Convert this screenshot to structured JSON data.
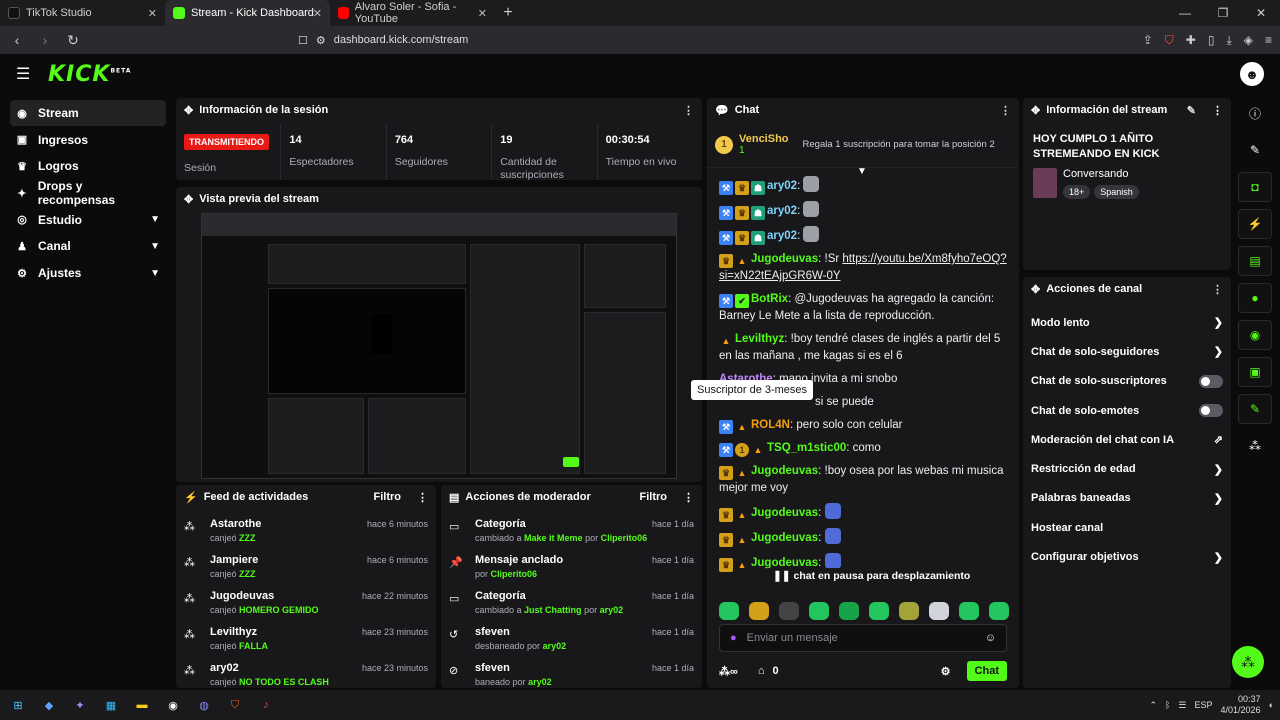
{
  "browser": {
    "tabs": [
      {
        "label": "TikTok Studio",
        "color": "#111111"
      },
      {
        "label": "Stream - Kick Dashboard",
        "color": "#53fc18"
      },
      {
        "label": "Alvaro Soler - Sofia - YouTube",
        "color": "#ff0000"
      }
    ],
    "url": "dashboard.kick.com/stream"
  },
  "header": {
    "logo": "KICK",
    "logo_sup": "BETA"
  },
  "sidebar": {
    "items": [
      {
        "label": "Stream",
        "icon": "broadcast-icon"
      },
      {
        "label": "Ingresos",
        "icon": "revenue-icon"
      },
      {
        "label": "Logros",
        "icon": "trophy-icon"
      },
      {
        "label": "Drops y recompensas",
        "icon": "gift-icon"
      },
      {
        "label": "Estudio",
        "icon": "studio-icon"
      },
      {
        "label": "Canal",
        "icon": "person-icon"
      },
      {
        "label": "Ajustes",
        "icon": "gear-icon"
      }
    ]
  },
  "session": {
    "title": "Información de la sesión",
    "status": "TRANSMITIENDO",
    "stats": [
      {
        "value": "",
        "label": "Sesión"
      },
      {
        "value": "14",
        "label": "Espectadores"
      },
      {
        "value": "764",
        "label": "Seguidores"
      },
      {
        "value": "19",
        "label": "Cantidad de suscripciones"
      },
      {
        "value": "00:30:54",
        "label": "Tiempo en vivo"
      }
    ]
  },
  "preview": {
    "title": "Vista previa del stream"
  },
  "feed": {
    "title": "Feed de actividades",
    "filter": "Filtro",
    "items": [
      {
        "name": "Astarothe",
        "action": "canjeó",
        "reward": "ZZZ",
        "time": "hace 6 minutos"
      },
      {
        "name": "Jampiere",
        "action": "canjeó",
        "reward": "ZZZ",
        "time": "hace 6 minutos"
      },
      {
        "name": "Jugodeuvas",
        "action": "canjeó",
        "reward": "HOMERO GEMIDO",
        "time": "hace 22 minutos"
      },
      {
        "name": "Levilthyz",
        "action": "canjeó",
        "reward": "FALLA",
        "time": "hace 23 minutos"
      },
      {
        "name": "ary02",
        "action": "canjeó",
        "reward": "NO TODO ES CLASH",
        "time": "hace 23 minutos"
      }
    ]
  },
  "mod": {
    "title": "Acciones de moderador",
    "filter": "Filtro",
    "items": [
      {
        "name": "Categoría",
        "pre": "cambiado a",
        "hl": "Make it Meme",
        "mid": "por",
        "by": "Cliperito06",
        "time": "hace 1 día"
      },
      {
        "name": "Mensaje anclado",
        "pre": "por",
        "hl": "Cliperito06",
        "mid": "",
        "by": "",
        "time": "hace 1 día"
      },
      {
        "name": "Categoría",
        "pre": "cambiado a",
        "hl": "Just Chatting",
        "mid": "por",
        "by": "ary02",
        "time": "hace 1 día"
      },
      {
        "name": "sfeven",
        "pre": "desbaneado por",
        "hl": "ary02",
        "mid": "",
        "by": "",
        "time": "hace 1 día"
      },
      {
        "name": "sfeven",
        "pre": "baneado por",
        "hl": "ary02",
        "mid": "",
        "by": "",
        "time": "hace 1 día"
      }
    ]
  },
  "chat": {
    "title": "Chat",
    "pinned_user": "VenciSho",
    "pinned_count": "1",
    "pinned_text": "Regala 1 suscripción para tomar la posición 2",
    "messages": [
      {
        "user": "ary02",
        "color": "#7dd3fc",
        "text": ""
      },
      {
        "user": "ary02",
        "color": "#7dd3fc",
        "text": ""
      },
      {
        "user": "ary02",
        "color": "#7dd3fc",
        "text": ""
      },
      {
        "user": "Jugodeuvas",
        "color": "#53fc18",
        "text": "!Sr",
        "link": "https://youtu.be/Xm8fyho7eOQ?si=xN22tEAjpGR6W-0Y"
      },
      {
        "user": "BotRix",
        "color": "#53fc18",
        "text": "@Jugodeuvas ha agregado la canción: Barney Le Mete a la lista de reproducción."
      },
      {
        "user": "Levilthyz",
        "color": "#53fc18",
        "text": "!boy tendré clases de inglés a partir del 5 en las mañana , me kagas si es el 6"
      },
      {
        "user": "Astarothe",
        "color": "#c084fc",
        "text": "mano invita a mi snobo"
      },
      {
        "user": "",
        "color": "#ffffff",
        "text": "si se puede"
      },
      {
        "user": "ROL4N",
        "color": "#f59e0b",
        "text": "pero solo con celular"
      },
      {
        "user": "TSQ_m1stic00",
        "color": "#53fc18",
        "text": "como"
      },
      {
        "user": "Jugodeuvas",
        "color": "#53fc18",
        "text": "!boy osea por las webas mi musica mejor me voy"
      },
      {
        "user": "Jugodeuvas",
        "color": "#53fc18",
        "text": ""
      },
      {
        "user": "Jugodeuvas",
        "color": "#53fc18",
        "text": ""
      },
      {
        "user": "Jugodeuvas",
        "color": "#53fc18",
        "text": ""
      }
    ],
    "tooltip": "Suscriptor de 3-meses",
    "paused": "chat en pausa para desplazamiento",
    "input_placeholder": "Enviar un mensaje",
    "points": "0",
    "send": "Chat"
  },
  "stream_info": {
    "title": "Información del stream",
    "stream_title": "HOY CUMPLO 1 AÑITO STREMEANDO EN KICK",
    "category": "Conversando",
    "tags": [
      "18+",
      "Spanish"
    ]
  },
  "channel_actions": {
    "title": "Acciones de canal",
    "items": [
      {
        "label": "Modo lento",
        "control": "arrow"
      },
      {
        "label": "Chat de solo-seguidores",
        "control": "arrow"
      },
      {
        "label": "Chat de solo-suscriptores",
        "control": "toggle"
      },
      {
        "label": "Chat de solo-emotes",
        "control": "toggle"
      },
      {
        "label": "Moderación del chat con IA",
        "control": "external"
      },
      {
        "label": "Restricción de edad",
        "control": "arrow"
      },
      {
        "label": "Palabras baneadas",
        "control": "arrow"
      },
      {
        "label": "Hostear canal",
        "control": "none"
      },
      {
        "label": "Configurar objetivos",
        "control": "arrow"
      }
    ]
  },
  "taskbar": {
    "lang": "ESP",
    "time": "00:37",
    "date": "4/01/2026"
  }
}
